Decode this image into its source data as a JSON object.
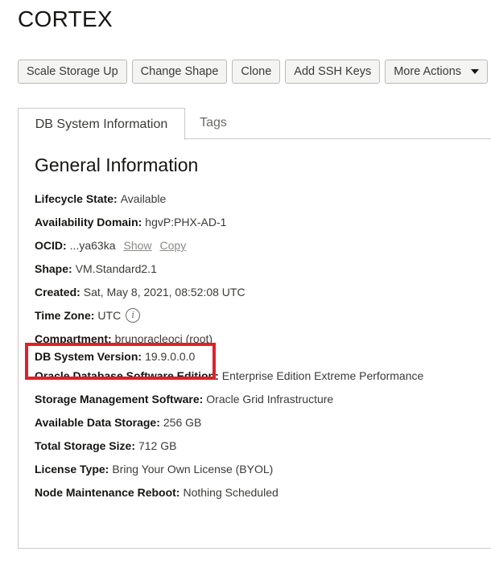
{
  "header": {
    "title": "CORTEX"
  },
  "toolbar": {
    "scale_storage": "Scale Storage Up",
    "change_shape": "Change Shape",
    "clone": "Clone",
    "add_ssh_keys": "Add SSH Keys",
    "more_actions": "More Actions"
  },
  "tabs": {
    "db_system_info": "DB System Information",
    "tags": "Tags"
  },
  "general": {
    "title": "General Information",
    "lifecycle_label": "Lifecycle State:",
    "lifecycle_value": "Available",
    "ad_label": "Availability Domain:",
    "ad_value": "hgvP:PHX-AD-1",
    "ocid_label": "OCID:",
    "ocid_value": "...ya63ka",
    "ocid_show": "Show",
    "ocid_copy": "Copy",
    "shape_label": "Shape:",
    "shape_value": "VM.Standard2.1",
    "created_label": "Created:",
    "created_value": "Sat, May 8, 2021, 08:52:08 UTC",
    "timezone_label": "Time Zone:",
    "timezone_value": "UTC",
    "compartment_label": "Compartment:",
    "compartment_value": "brunoracleoci (root)",
    "version_label": "DB System Version:",
    "version_value": "19.9.0.0.0",
    "edition_label": "Oracle Database Software Edition:",
    "edition_value": "Enterprise Edition Extreme Performance",
    "storage_mgmt_label": "Storage Management Software:",
    "storage_mgmt_value": "Oracle Grid Infrastructure",
    "avail_storage_label": "Available Data Storage:",
    "avail_storage_value": "256 GB",
    "total_storage_label": "Total Storage Size:",
    "total_storage_value": "712 GB",
    "license_label": "License Type:",
    "license_value": "Bring Your Own License (BYOL)",
    "reboot_label": "Node Maintenance Reboot:",
    "reboot_value": "Nothing Scheduled"
  },
  "icons": {
    "info": "info-icon",
    "caret": "caret-down-icon"
  },
  "colors": {
    "highlight": "#e0202a",
    "link": "#8a8986"
  }
}
